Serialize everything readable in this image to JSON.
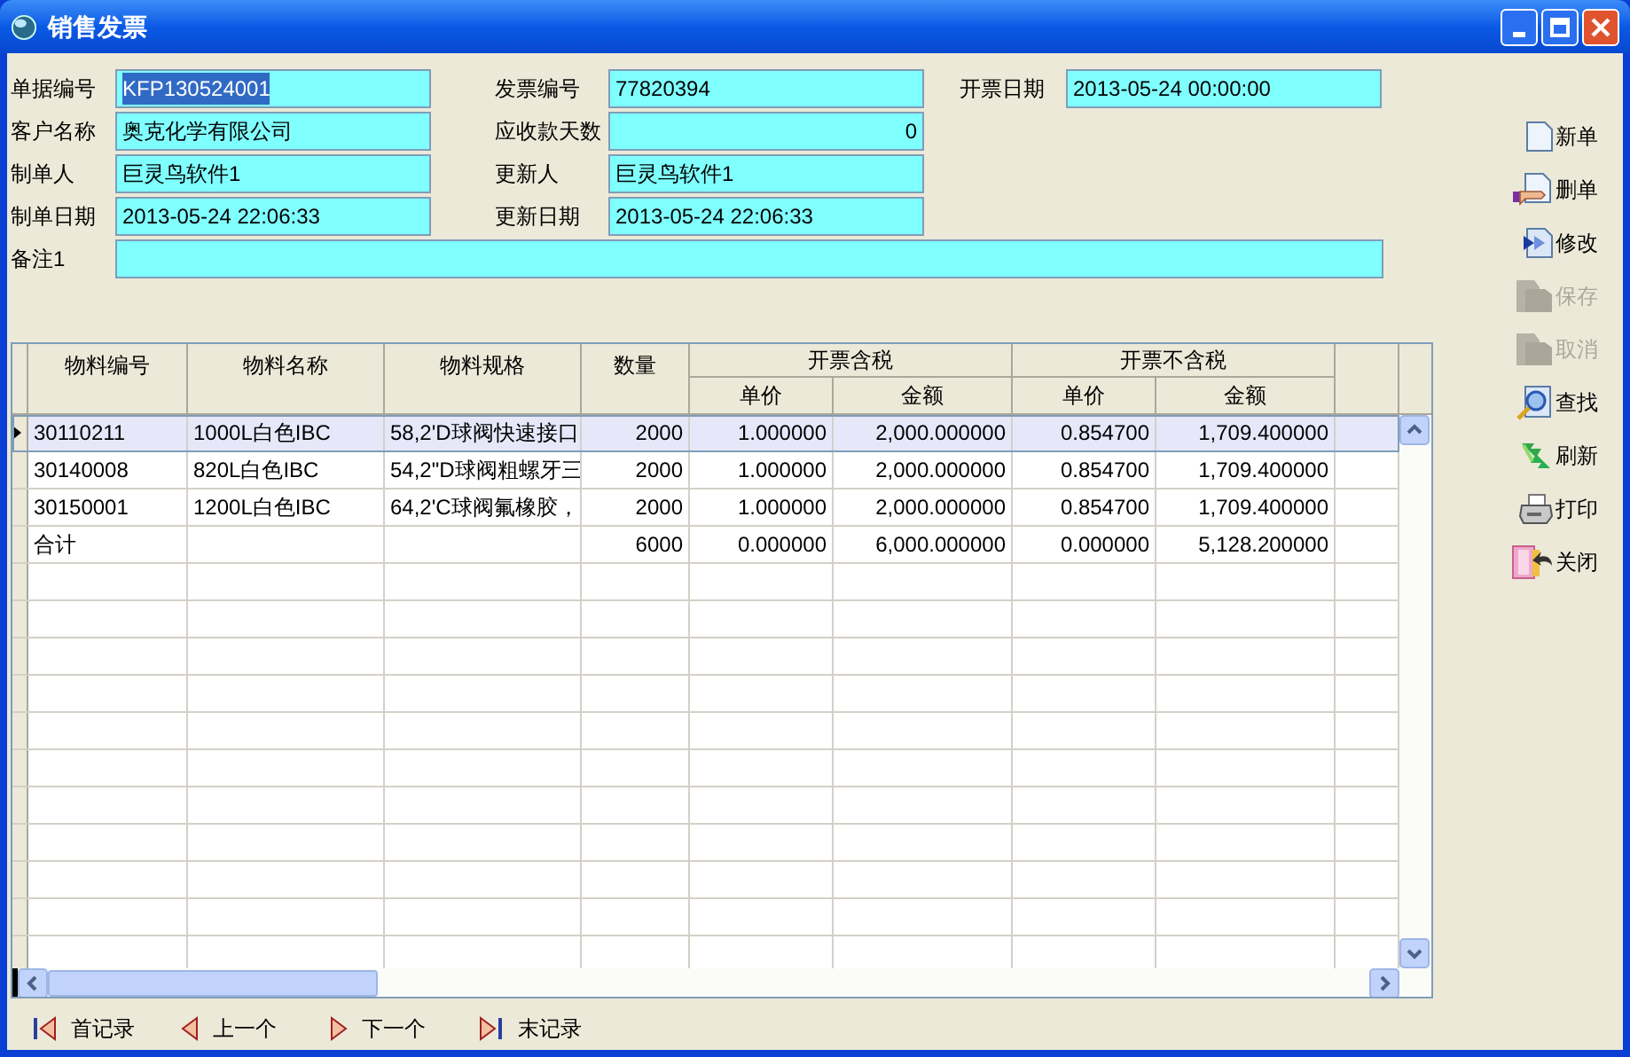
{
  "window": {
    "title": "销售发票"
  },
  "form": {
    "rows": [
      [
        {
          "label": "单据编号",
          "value": "KFP130524001",
          "selected": true,
          "kind": "text"
        },
        {
          "label": "发票编号",
          "value": "77820394",
          "selected": false,
          "kind": "text"
        },
        {
          "label": "开票日期",
          "value": "2013-05-24 00:00:00",
          "selected": false,
          "kind": "text"
        }
      ],
      [
        {
          "label": "客户名称",
          "value": "奥克化学有限公司",
          "selected": false,
          "kind": "text"
        },
        {
          "label": "应收款天数",
          "value": "0",
          "selected": false,
          "kind": "number"
        }
      ],
      [
        {
          "label": "制单人",
          "value": "巨灵鸟软件1",
          "selected": false,
          "kind": "text"
        },
        {
          "label": "更新人",
          "value": "巨灵鸟软件1",
          "selected": false,
          "kind": "text"
        }
      ],
      [
        {
          "label": "制单日期",
          "value": "2013-05-24 22:06:33",
          "selected": false,
          "kind": "text"
        },
        {
          "label": "更新日期",
          "value": "2013-05-24 22:06:33",
          "selected": false,
          "kind": "text"
        }
      ],
      [
        {
          "label": "备注1",
          "kind": "wide"
        }
      ]
    ]
  },
  "toolbar": [
    {
      "label": "新单",
      "disabled": false
    },
    {
      "label": "删单",
      "disabled": false
    },
    {
      "label": "修改",
      "disabled": false
    },
    {
      "label": "保存",
      "disabled": true
    },
    {
      "label": "取消",
      "disabled": true
    },
    {
      "label": "查找",
      "disabled": false
    },
    {
      "label": "刷新",
      "disabled": false
    },
    {
      "label": "打印",
      "disabled": false
    },
    {
      "label": "关闭",
      "disabled": false
    }
  ],
  "table": {
    "header_rows": [
      [
        {
          "label": "物料编号",
          "rowspan": 2
        },
        {
          "label": "物料名称",
          "rowspan": 2
        },
        {
          "label": "物料规格",
          "rowspan": 2
        },
        {
          "label": "数量",
          "rowspan": 2
        },
        {
          "label": "开票含税",
          "colspan": 2
        },
        {
          "label": "开票不含税",
          "colspan": 2
        }
      ],
      [
        {
          "label": "单价"
        },
        {
          "label": "金额"
        },
        {
          "label": "单价"
        },
        {
          "label": "金额"
        }
      ]
    ],
    "rows": [
      {
        "selected": true,
        "cells": [
          "30110211",
          "1000L白色IBC",
          "58,2'D球阀快速接口",
          "2000",
          "1.000000",
          "2,000.000000",
          "0.854700",
          "1,709.400000"
        ]
      },
      {
        "selected": false,
        "cells": [
          "30140008",
          "820L白色IBC",
          "54,2\"D球阀粗螺牙三",
          "2000",
          "1.000000",
          "2,000.000000",
          "0.854700",
          "1,709.400000"
        ]
      },
      {
        "selected": false,
        "cells": [
          "30150001",
          "1200L白色IBC",
          "64,2'C球阀氟橡胶，",
          "2000",
          "1.000000",
          "2,000.000000",
          "0.854700",
          "1,709.400000"
        ]
      },
      {
        "selected": false,
        "cells": [
          "合计",
          "",
          "",
          "6000",
          "0.000000",
          "6,000.000000",
          "0.000000",
          "5,128.200000"
        ]
      }
    ]
  },
  "navigation": [
    {
      "label": "首记录",
      "kind": "first"
    },
    {
      "label": "上一个",
      "kind": "prev"
    },
    {
      "label": "下一个",
      "kind": "next"
    },
    {
      "label": "末记录",
      "kind": "last"
    }
  ]
}
